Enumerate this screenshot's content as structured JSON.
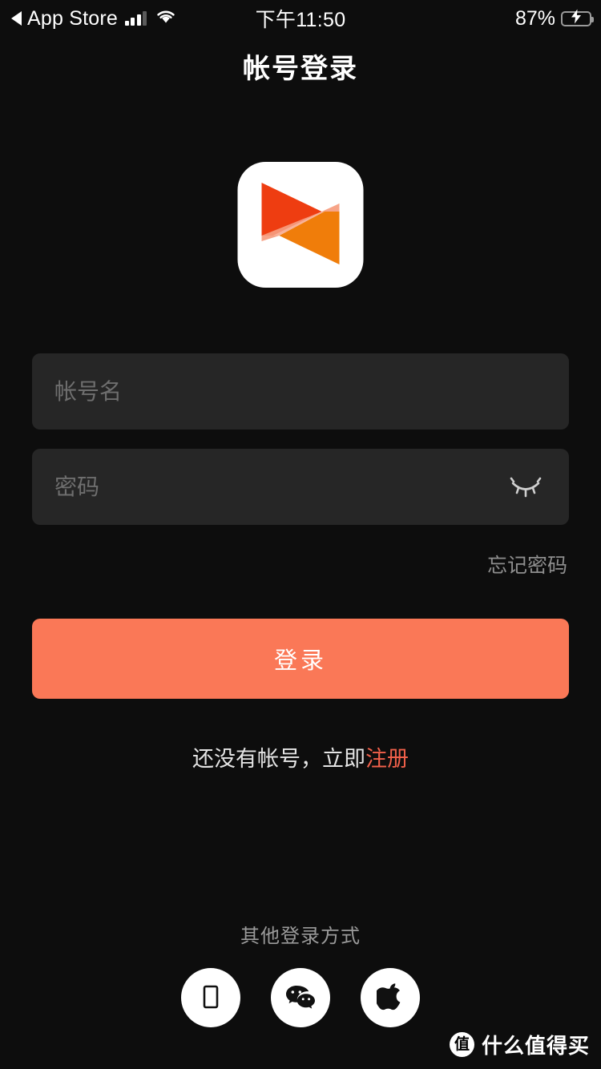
{
  "statusbar": {
    "back_label": "App Store",
    "back_icon": "back-triangle-icon",
    "signal_icon": "cellular-signal-icon",
    "wifi_icon": "wifi-icon",
    "time": "下午11:50",
    "battery_percent": "87%",
    "battery_icon": "battery-charging-icon",
    "battery_level": 87
  },
  "header": {
    "title": "帐号登录"
  },
  "logo": {
    "name": "app-logo",
    "colors": {
      "background": "#ffffff",
      "triangle_top": "#ee3d11",
      "triangle_bottom": "#f07d0a",
      "overlap": "#f7a488"
    }
  },
  "form": {
    "account": {
      "placeholder": "帐号名",
      "value": ""
    },
    "password": {
      "placeholder": "密码",
      "value": "",
      "toggle_icon": "eye-closed-icon"
    },
    "forgot_password": "忘记密码",
    "submit_label": "登录",
    "submit_color": "#fa7857"
  },
  "register": {
    "prefix": "还没有帐号，立即",
    "link": "注册",
    "link_color": "#f0604a"
  },
  "other_login": {
    "label": "其他登录方式",
    "methods": [
      {
        "name": "phone-login",
        "icon": "phone-icon"
      },
      {
        "name": "wechat-login",
        "icon": "wechat-icon"
      },
      {
        "name": "apple-login",
        "icon": "apple-icon"
      }
    ]
  },
  "watermark": {
    "badge": "值",
    "text": "什么值得买"
  }
}
